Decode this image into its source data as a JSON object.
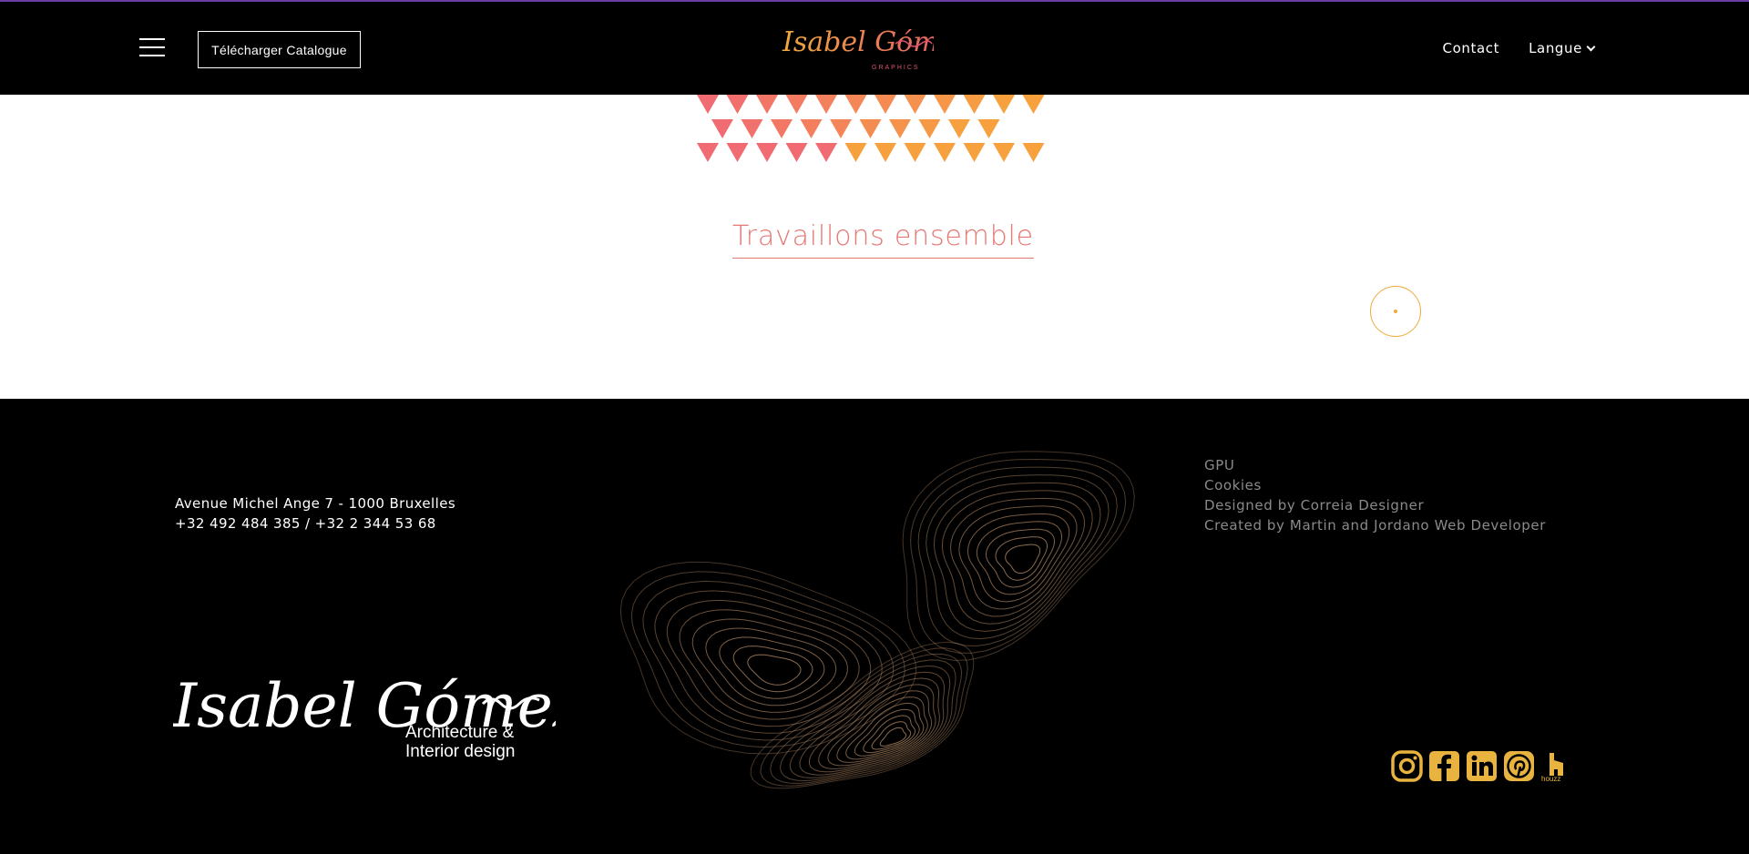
{
  "header": {
    "catalog_button": "Télécharger Catalogue",
    "nav": {
      "contact": "Contact",
      "language": "Langue"
    },
    "logo_name": "Isabel Gómez",
    "logo_tag": "GRAPHICS"
  },
  "main": {
    "cta_label": "Travaillons ensemble"
  },
  "footer": {
    "address_line1": "Avenue Michel Ange 7 - 1000 Bruxelles",
    "address_line2": "+32 492 484 385 / +32 2 344 53 68",
    "links": [
      "GPU",
      "Cookies",
      "Designed by Correia Designer",
      "Created by Martin and Jordano Web Developer"
    ],
    "logo_name": "Isabel Gómez",
    "logo_sub_line1": "Architecture &",
    "logo_sub_line2": "Interior design",
    "socials": [
      "instagram-icon",
      "facebook-icon",
      "linkedin-icon",
      "pinterest-icon",
      "houzz-icon"
    ],
    "houzz_text": "houzz"
  },
  "colors": {
    "accent_pink": "#e57873",
    "accent_orange": "#f0a93a",
    "social_gold": "#e8b33e",
    "header_border": "#6a3fa3"
  }
}
